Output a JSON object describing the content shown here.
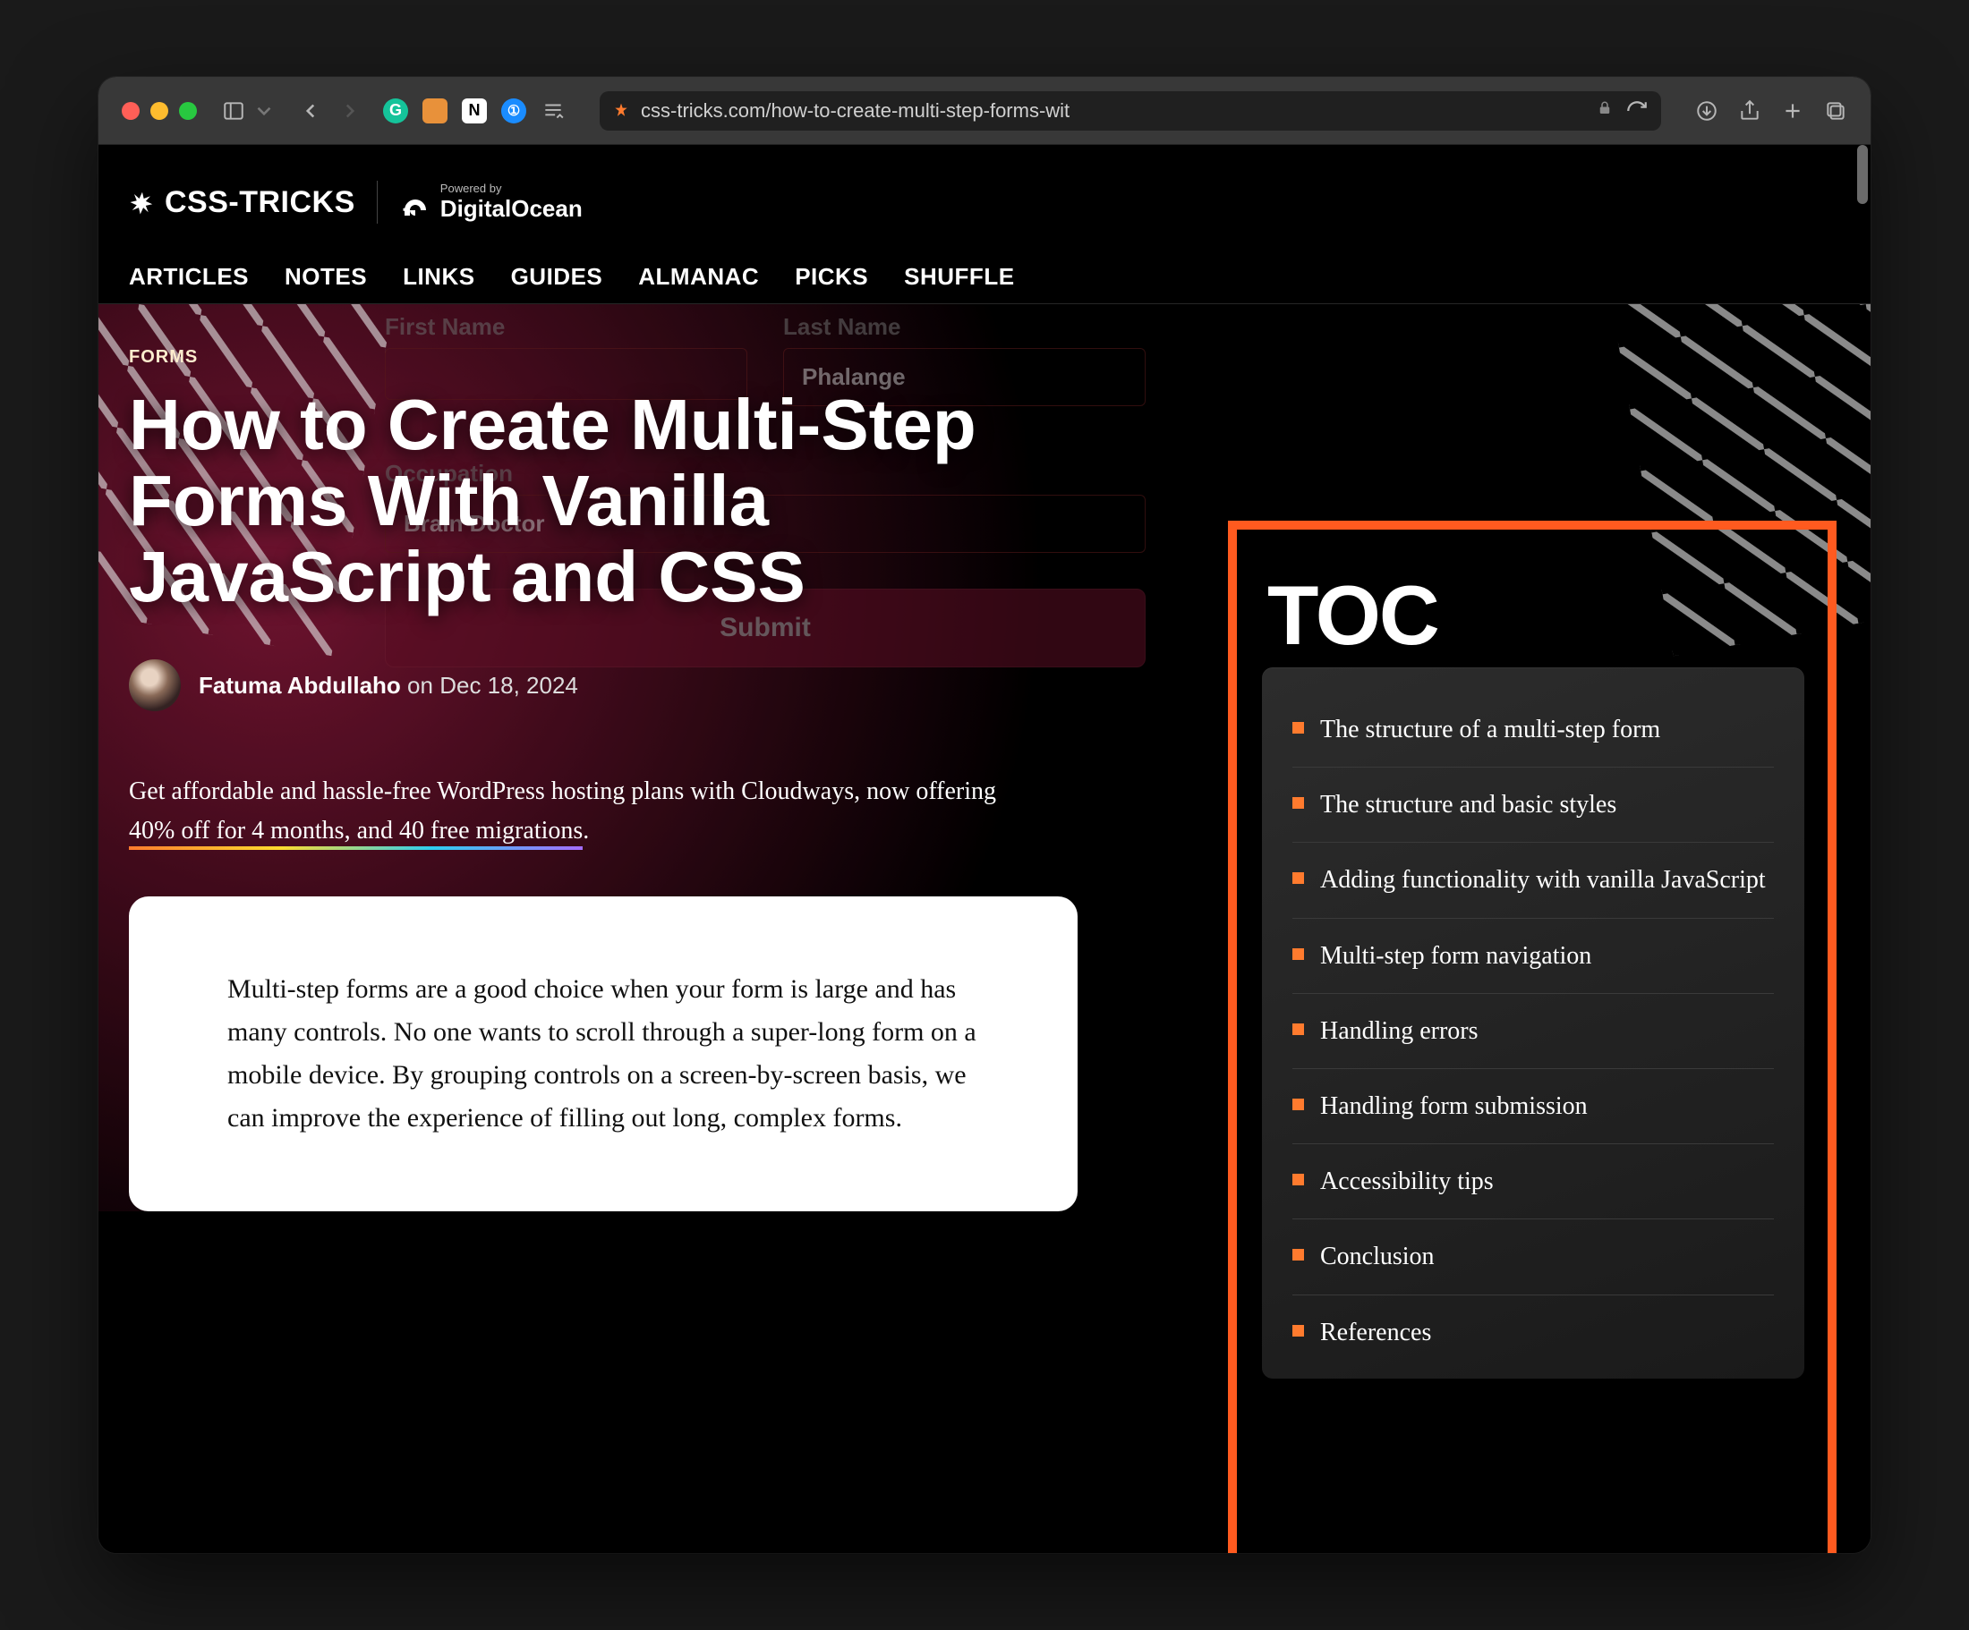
{
  "browser": {
    "url_display": "css-tricks.com/how-to-create-multi-step-forms-wit"
  },
  "site": {
    "name": "CSS-TRICKS",
    "powered_by_label": "Powered by",
    "powered_by": "DigitalOcean",
    "nav": [
      "ARTICLES",
      "NOTES",
      "LINKS",
      "GUIDES",
      "ALMANAC",
      "PICKS",
      "SHUFFLE"
    ]
  },
  "hero": {
    "eyebrow": "FORMS",
    "title": "How to Create Multi-Step Forms With Vanilla JavaScript and CSS",
    "author": "Fatuma Abdullaho",
    "on_label": "on",
    "date": "Dec 18, 2024",
    "bg_form": {
      "first_name_label": "First Name",
      "last_name_label": "Last Name",
      "last_name_value": "Phalange",
      "occupation_label": "Occupation",
      "occupation_value": "Brain Doctor",
      "submit": "Submit"
    }
  },
  "promo": {
    "lead": "Get affordable and hassle-free WordPress hosting plans with Cloudways, now offering ",
    "highlight": "40% off for 4 months, and 40 free migrations",
    "tail": "."
  },
  "article": {
    "p1": "Multi-step forms are a good choice when your form is large and has many controls. No one wants to scroll through a super-long form on a mobile device. By grouping controls on a screen-by-screen basis, we can improve the experience of filling out long, complex forms."
  },
  "toc": {
    "heading": "TOC",
    "items": [
      "The structure of a multi-step form",
      "The structure and basic styles",
      "Adding functionality with vanilla JavaScript",
      "Multi-step form navigation",
      "Handling errors",
      "Handling form submission",
      "Accessibility tips",
      "Conclusion",
      "References"
    ]
  }
}
